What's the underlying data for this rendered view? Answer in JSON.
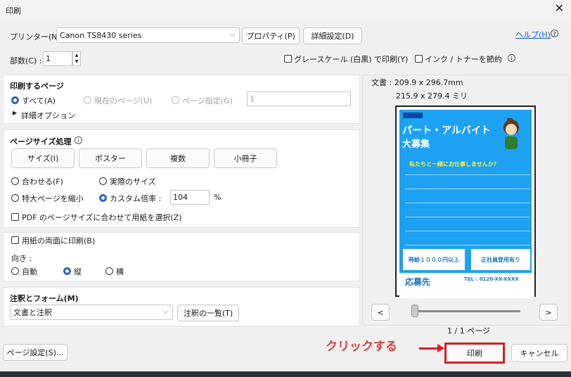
{
  "window": {
    "title": "印刷",
    "close": "✕"
  },
  "printer": {
    "label": "プリンター(N) :",
    "value": "Canon TS8430 series",
    "properties": "プロパティ(P)",
    "advanced": "詳細設定(D)",
    "help": "ヘルプ(H)"
  },
  "copies": {
    "label": "部数(C) :",
    "value": "1"
  },
  "options": {
    "grayscale": "グレースケール (白黒) で印刷(Y)",
    "save_ink": "インク / トナーを節約"
  },
  "pages": {
    "title": "印刷するページ",
    "all": "すべて(A)",
    "current": "現在のページ(U)",
    "specify": "ページ指定(G)",
    "range_value": "1",
    "more": "詳細オプション"
  },
  "sizing": {
    "title": "ページサイズ処理",
    "size": "サイズ(I)",
    "poster": "ポスター",
    "multiple": "複数",
    "booklet": "小冊子",
    "fit": "合わせる(F)",
    "actual": "実際のサイズ",
    "shrink": "特大ページを縮小",
    "custom": "カスタム倍率 :",
    "scale_value": "104",
    "percent": "%",
    "pdf_paper": "PDF のページサイズに合わせて用紙を選択(Z)"
  },
  "duplex": {
    "label": "用紙の両面に印刷(B)"
  },
  "orientation": {
    "label": "向き :",
    "auto": "自動",
    "portrait": "縦",
    "landscape": "横"
  },
  "comments": {
    "title": "注釈とフォーム(M)",
    "value": "文書と注釈",
    "summary": "注釈の一覧(T)"
  },
  "doc": {
    "size": "文書 : 209.9 x 296.7mm",
    "paper": "215.9 x 279.4 ミリ",
    "page": "1 / 1 ページ"
  },
  "flyer": {
    "title1": "パート・アルバイト",
    "title2": "大募集",
    "tagline": "私たちと一緒にお仕事しませんか？",
    "box1": "時給１０００円以上",
    "box2": "正社員登用有り",
    "contact": "応募先",
    "tel": "TEL : 0120-XX-XXXX"
  },
  "nav": {
    "prev": "<",
    "next": ">"
  },
  "buttons": {
    "page_setup": "ページ設定(S)...",
    "print": "印刷",
    "cancel": "キャンセル"
  },
  "annotation": {
    "text": "クリックする"
  },
  "colors": {
    "accent": "#2d63c8",
    "highlight": "#d81e1e",
    "flyer_bg": "#1da1f2"
  },
  "icons": {
    "info": "info-icon",
    "chevron": "chevron-down-icon",
    "expand": "triangle-right-icon"
  }
}
